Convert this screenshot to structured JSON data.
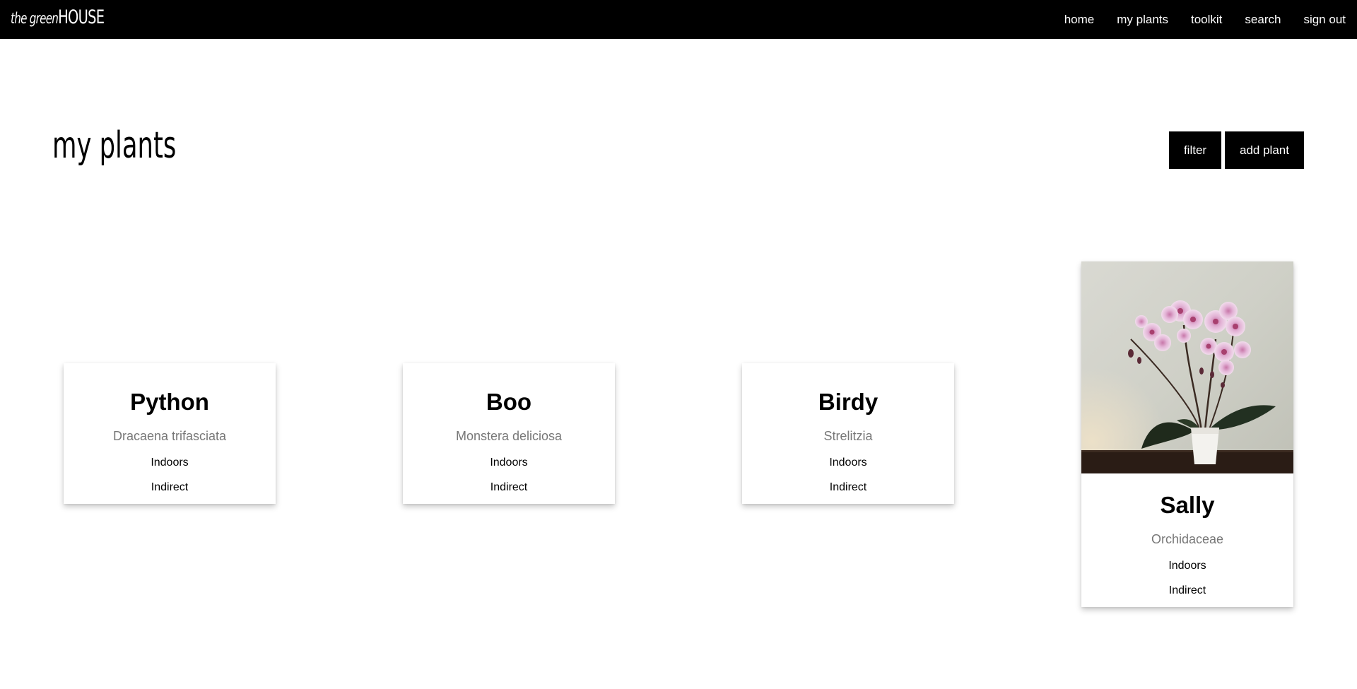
{
  "brand": {
    "prefix": "the green",
    "suffix": "HOUSE"
  },
  "nav": [
    {
      "label": "home"
    },
    {
      "label": "my plants"
    },
    {
      "label": "toolkit"
    },
    {
      "label": "search"
    },
    {
      "label": "sign out"
    }
  ],
  "page": {
    "title": "my plants",
    "filter_label": "filter",
    "add_label": "add plant"
  },
  "plants": [
    {
      "name": "Python",
      "species": "Dracaena trifasciata",
      "location": "Indoors",
      "light": "Indirect"
    },
    {
      "name": "Boo",
      "species": "Monstera deliciosa",
      "location": "Indoors",
      "light": "Indirect"
    },
    {
      "name": "Birdy",
      "species": "Strelitzia",
      "location": "Indoors",
      "light": "Indirect"
    },
    {
      "name": "Sally",
      "species": "Orchidaceae",
      "location": "Indoors",
      "light": "Indirect",
      "photo": "orchid-photo"
    }
  ]
}
